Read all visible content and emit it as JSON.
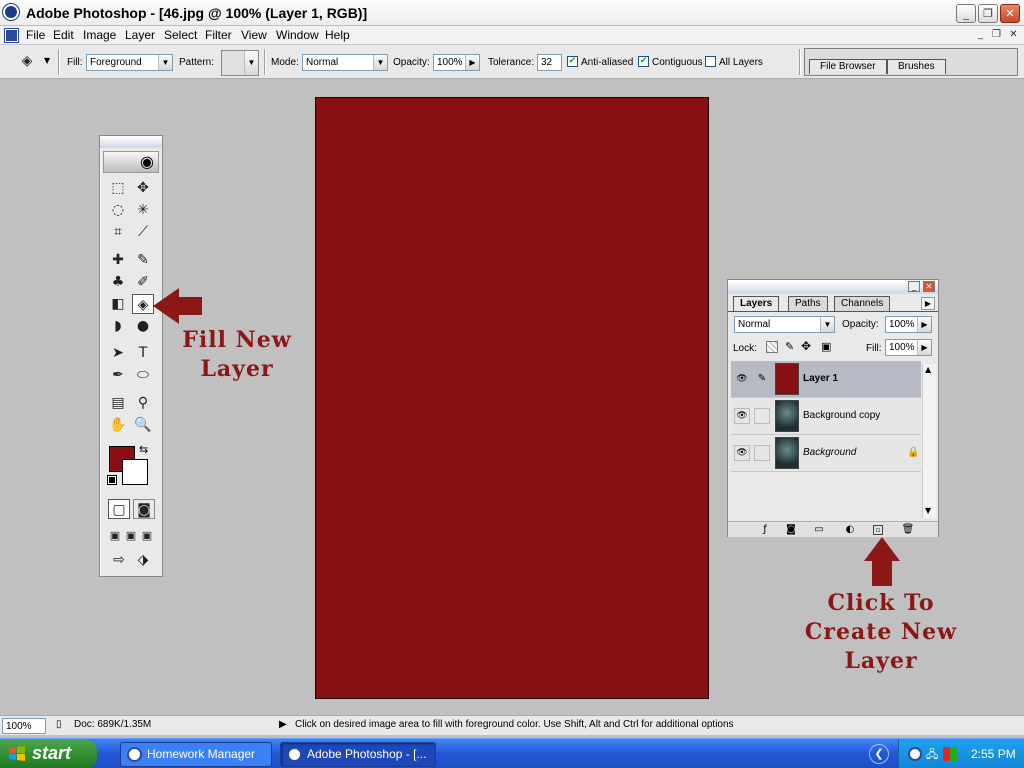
{
  "window": {
    "title": "Adobe Photoshop - [46.jpg @ 100% (Layer 1, RGB)]",
    "min_glyph": "_",
    "max_glyph": "❐",
    "close_glyph": "✕"
  },
  "menu": {
    "items": [
      "File",
      "Edit",
      "Image",
      "Layer",
      "Select",
      "Filter",
      "View",
      "Window",
      "Help"
    ]
  },
  "options": {
    "fill_label": "Fill:",
    "fill_value": "Foreground",
    "pattern_label": "Pattern:",
    "mode_label": "Mode:",
    "mode_value": "Normal",
    "opacity_label": "Opacity:",
    "opacity_value": "100%",
    "tolerance_label": "Tolerance:",
    "tolerance_value": "32",
    "anti_aliased_label": "Anti-aliased",
    "anti_aliased_checked": true,
    "contiguous_label": "Contiguous",
    "contiguous_checked": true,
    "all_layers_label": "All Layers",
    "all_layers_checked": false,
    "well_tabs": [
      "File Browser",
      "Brushes"
    ]
  },
  "canvas": {
    "fill_color": "#861014"
  },
  "colors": {
    "foreground": "#861014",
    "background": "#ffffff",
    "annotation": "#8b1717"
  },
  "toolbox": {
    "tools": [
      {
        "name": "marquee-icon",
        "glyph": "⬚"
      },
      {
        "name": "move-icon",
        "glyph": "✥"
      },
      {
        "name": "lasso-icon",
        "glyph": "◌"
      },
      {
        "name": "magic-wand-icon",
        "glyph": "✳"
      },
      {
        "name": "crop-icon",
        "glyph": "⌗"
      },
      {
        "name": "slice-icon",
        "glyph": "⟋"
      },
      {
        "name": "healing-brush-icon",
        "glyph": "✚"
      },
      {
        "name": "brush-icon",
        "glyph": "✎"
      },
      {
        "name": "clone-stamp-icon",
        "glyph": "♣"
      },
      {
        "name": "history-brush-icon",
        "glyph": "✐"
      },
      {
        "name": "eraser-icon",
        "glyph": "◧"
      },
      {
        "name": "paint-bucket-icon",
        "glyph": "◈"
      },
      {
        "name": "blur-icon",
        "glyph": "◗"
      },
      {
        "name": "dodge-icon",
        "glyph": "●"
      },
      {
        "name": "path-selection-icon",
        "glyph": "➤"
      },
      {
        "name": "type-icon",
        "glyph": "T"
      },
      {
        "name": "pen-icon",
        "glyph": "✒"
      },
      {
        "name": "shape-icon",
        "glyph": "⬭"
      },
      {
        "name": "notes-icon",
        "glyph": "▤"
      },
      {
        "name": "eyedropper-icon",
        "glyph": "⚲"
      },
      {
        "name": "hand-icon",
        "glyph": "✋"
      },
      {
        "name": "zoom-icon",
        "glyph": "🔍"
      }
    ]
  },
  "annotations": {
    "fill_new_layer_line1": "Fill New",
    "fill_new_layer_line2": "Layer",
    "create_layer_line1": "Click To",
    "create_layer_line2": "Create New",
    "create_layer_line3": "Layer"
  },
  "layers_panel": {
    "tabs": [
      "Layers",
      "Paths",
      "Channels"
    ],
    "blend_mode": "Normal",
    "opacity_label": "Opacity:",
    "opacity_value": "100%",
    "lock_label": "Lock:",
    "fill_label": "Fill:",
    "fill_value": "100%",
    "layers": [
      {
        "name": "Layer 1",
        "selected": true
      },
      {
        "name": "Background copy",
        "selected": false
      },
      {
        "name": "Background",
        "selected": false
      }
    ]
  },
  "status": {
    "zoom": "100%",
    "doc": "Doc: 689K/1.35M",
    "hint": "Click on desired image area to fill with foreground color.  Use Shift, Alt and Ctrl for additional options"
  },
  "taskbar": {
    "start_label": "start",
    "tasks": [
      "Homework Manager -...",
      "Adobe Photoshop - [..."
    ],
    "clock": "2:55 PM"
  }
}
